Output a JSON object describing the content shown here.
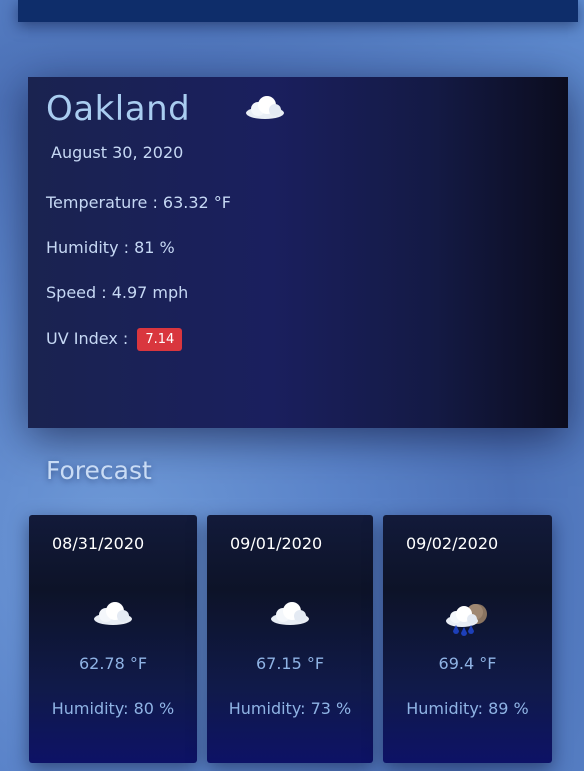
{
  "current": {
    "city": "Oakland",
    "icon": "cloud-icon",
    "date": "August 30, 2020",
    "temperature": "Temperature : 63.32 °F",
    "humidity": "Humidity : 81 %",
    "speed": "Speed : 4.97 mph",
    "uv_label": "UV Index :",
    "uv_value": "7.14",
    "uv_color": "#d9363e"
  },
  "forecast_title": "Forecast",
  "forecast": [
    {
      "date": "08/31/2020",
      "icon": "cloud-icon",
      "temp": "62.78 °F",
      "humidity": "Humidity: 80 %"
    },
    {
      "date": "09/01/2020",
      "icon": "cloud-icon",
      "temp": "67.15 °F",
      "humidity": "Humidity: 73 %"
    },
    {
      "date": "09/02/2020",
      "icon": "rain-icon",
      "temp": "69.4 °F",
      "humidity": "Humidity: 89 %"
    }
  ]
}
